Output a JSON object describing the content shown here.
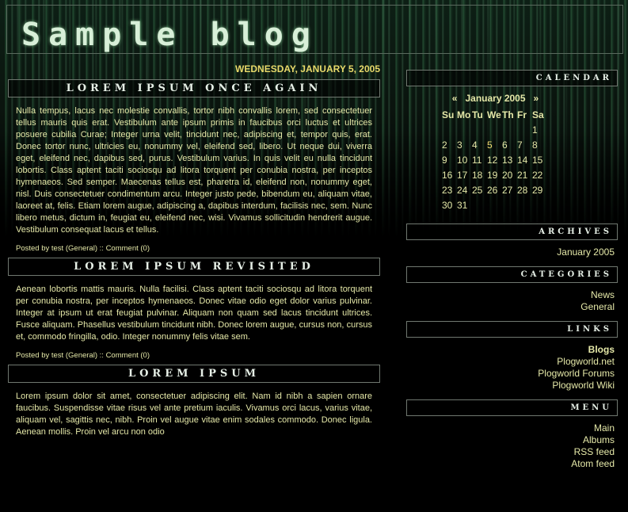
{
  "site": {
    "title": "Sample blog"
  },
  "date": "WEDNESDAY, JANUARY 5, 2005",
  "posts": [
    {
      "title": "LOREM IPSUM ONCE AGAIN",
      "body": "Nulla tempus, lacus nec molestie convallis, tortor nibh convallis lorem, sed consectetuer tellus mauris quis erat. Vestibulum ante ipsum primis in faucibus orci luctus et ultrices posuere cubilia Curae; Integer urna velit, tincidunt nec, adipiscing et, tempor quis, erat. Donec tortor nunc, ultricies eu, nonummy vel, eleifend sed, libero. Ut neque dui, viverra eget, eleifend nec, dapibus sed, purus. Vestibulum varius. In quis velit eu nulla tincidunt lobortis. Class aptent taciti sociosqu ad litora torquent per conubia nostra, per inceptos hymenaeos. Sed semper. Maecenas tellus est, pharetra id, eleifend non, nonummy eget, nisl. Duis consectetuer condimentum arcu. Integer justo pede, bibendum eu, aliquam vitae, laoreet at, felis. Etiam lorem augue, adipiscing a, dapibus interdum, facilisis nec, sem. Nunc libero metus, dictum in, feugiat eu, eleifend nec, wisi. Vivamus sollicitudin hendrerit augue. Vestibulum consequat lacus et tellus.",
      "meta_prefix": "Posted by test (",
      "category": "General",
      "meta_sep": ") :: ",
      "comment": "Comment (0)"
    },
    {
      "title": "LOREM IPSUM REVISITED",
      "body": "Aenean lobortis mattis mauris. Nulla facilisi. Class aptent taciti sociosqu ad litora torquent per conubia nostra, per inceptos hymenaeos. Donec vitae odio eget dolor varius pulvinar. Integer at ipsum ut erat feugiat pulvinar. Aliquam non quam sed lacus tincidunt ultrices. Fusce aliquam. Phasellus vestibulum tincidunt nibh. Donec lorem augue, cursus non, cursus et, commodo fringilla, odio. Integer nonummy felis vitae sem.",
      "meta_prefix": "Posted by test (",
      "category": "General",
      "meta_sep": ") :: ",
      "comment": "Comment (0)"
    },
    {
      "title": "LOREM IPSUM",
      "body": "Lorem ipsum dolor sit amet, consectetuer adipiscing elit. Nam id nibh a sapien ornare faucibus. Suspendisse vitae risus vel ante pretium iaculis. Vivamus orci lacus, varius vitae, aliquam vel, sagittis nec, nibh. Proin vel augue vitae enim sodales commodo. Donec ligula. Aenean mollis. Proin vel arcu non odio"
    }
  ],
  "sidebar": {
    "calendar": {
      "title": "CALENDAR",
      "prev": "«",
      "month": "January 2005",
      "next": "»",
      "weekdays": [
        "Su",
        "Mo",
        "Tu",
        "We",
        "Th",
        "Fr",
        "Sa"
      ],
      "weeks": [
        [
          "",
          "",
          "",
          "",
          "",
          "",
          "1"
        ],
        [
          "2",
          "3",
          "4",
          "5",
          "6",
          "7",
          "8"
        ],
        [
          "9",
          "10",
          "11",
          "12",
          "13",
          "14",
          "15"
        ],
        [
          "16",
          "17",
          "18",
          "19",
          "20",
          "21",
          "22"
        ],
        [
          "23",
          "24",
          "25",
          "26",
          "27",
          "28",
          "29"
        ],
        [
          "30",
          "31",
          "",
          "",
          "",
          "",
          ""
        ]
      ],
      "linked_day": "5"
    },
    "archives": {
      "title": "ARCHIVES",
      "items": [
        "January 2005"
      ]
    },
    "categories": {
      "title": "CATEGORIES",
      "items": [
        "News",
        "General"
      ]
    },
    "links": {
      "title": "LINKS",
      "group": "Blogs",
      "items": [
        "Plogworld.net",
        "Plogworld Forums",
        "Plogworld Wiki"
      ]
    },
    "menu": {
      "title": "MENU",
      "items": [
        "Main",
        "Albums",
        "RSS feed",
        "Atom feed"
      ]
    }
  },
  "colors": {
    "accent": "#e8d96a",
    "text": "#e5e8a8",
    "background": "#000000"
  }
}
